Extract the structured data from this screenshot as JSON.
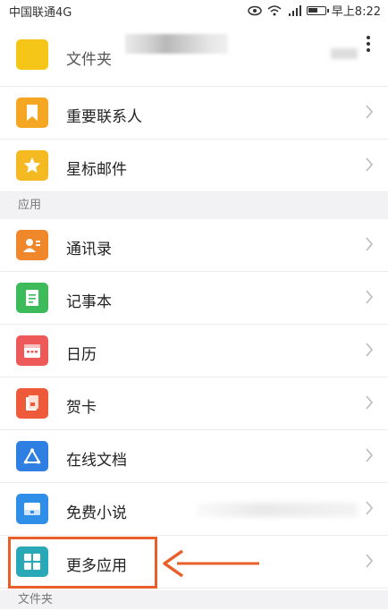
{
  "status_bar": {
    "carrier": "中国联通4G",
    "time": "早上8:22"
  },
  "top_item": {
    "label": "文件夹"
  },
  "mailbox_items": [
    {
      "label": "重要联系人",
      "icon": "bookmark-icon",
      "color": "#f5a623"
    },
    {
      "label": "星标邮件",
      "icon": "star-icon",
      "color": "#f5b921"
    }
  ],
  "apps_section": {
    "title": "应用",
    "items": [
      {
        "label": "通讯录",
        "icon": "contacts-icon",
        "color": "#f0882b"
      },
      {
        "label": "记事本",
        "icon": "notepad-icon",
        "color": "#3dbb5a"
      },
      {
        "label": "日历",
        "icon": "calendar-icon",
        "color": "#ee5a5a"
      },
      {
        "label": "贺卡",
        "icon": "greeting-card-icon",
        "color": "#ef5b3a"
      },
      {
        "label": "在线文档",
        "icon": "online-docs-icon",
        "color": "#2f7fe3"
      },
      {
        "label": "免费小说",
        "icon": "novel-icon",
        "color": "#2f8fe8"
      },
      {
        "label": "更多应用",
        "icon": "more-apps-icon",
        "color": "#29a9b8"
      }
    ]
  },
  "folder_section": {
    "title": "文件夹"
  }
}
